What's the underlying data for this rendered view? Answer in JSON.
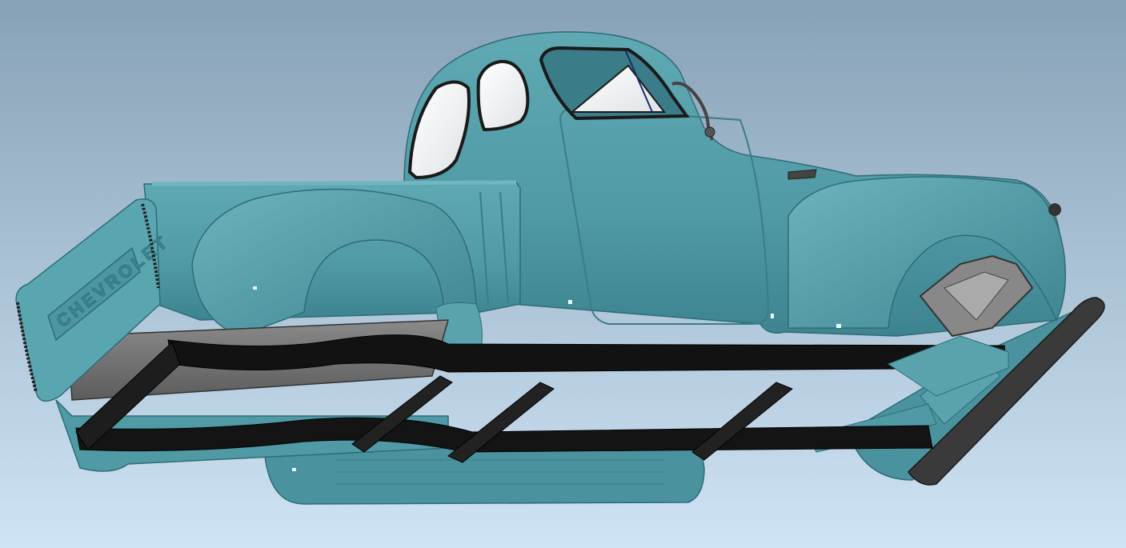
{
  "viewport": {
    "background_top": "#87a1b6",
    "background_bottom": "#cfe4f5"
  },
  "model": {
    "body_color": "#4f9aa5",
    "body_shadow": "#3a7c87",
    "body_highlight": "#7fc1cb",
    "frame_color": "#111111",
    "frame_dark": "#2a2a2a",
    "bed_floor_color": "#7a7a7a",
    "glass_color": "#f4f6f8",
    "chrome_color": "#4a4a4a",
    "tailgate_text": "CHEVROLET"
  }
}
